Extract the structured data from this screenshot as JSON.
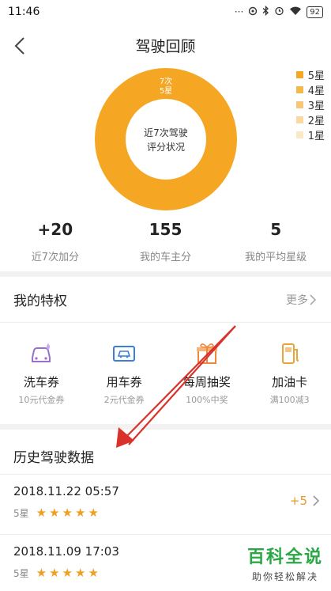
{
  "status_bar": {
    "time": "11:46",
    "battery": "92"
  },
  "header": {
    "title": "驾驶回顾"
  },
  "chart_data": {
    "type": "pie",
    "ring_label": "7次\n5星",
    "center_text": "近7次驾驶\n评分状况",
    "categories": [
      "5星",
      "4星",
      "3星",
      "2星",
      "1星"
    ],
    "values": [
      7,
      0,
      0,
      0,
      0
    ],
    "colors": [
      "#f5a623",
      "#f5b84a",
      "#f7c777",
      "#f9d9a0",
      "#fbe8c6"
    ],
    "legend_position": "top-right"
  },
  "stats": [
    {
      "value": "+20",
      "label": "近7次加分"
    },
    {
      "value": "155",
      "label": "我的车主分"
    },
    {
      "value": "5",
      "label": "我的平均星级"
    }
  ],
  "privileges": {
    "title": "我的特权",
    "more": "更多",
    "items": [
      {
        "name": "洗车券",
        "sub": "10元代金券",
        "icon": "car-wash-icon",
        "color": "#9b6fd0"
      },
      {
        "name": "用车券",
        "sub": "2元代金券",
        "icon": "car-ticket-icon",
        "color": "#3c7fd8"
      },
      {
        "name": "每周抽奖",
        "sub": "100%中奖",
        "icon": "gift-icon",
        "color": "#f0883a"
      },
      {
        "name": "加油卡",
        "sub": "满100减3",
        "icon": "fuel-icon",
        "color": "#e9a53a"
      }
    ]
  },
  "history": {
    "title": "历史驾驶数据",
    "rows": [
      {
        "date": "2018.11.22 05:57",
        "stars_label": "5星",
        "stars": 5,
        "score": "+5"
      },
      {
        "date": "2018.11.09 17:03",
        "stars_label": "5星",
        "stars": 5,
        "score": ""
      }
    ]
  },
  "watermark": {
    "title": "百科全说",
    "sub": "助你轻松解决"
  }
}
